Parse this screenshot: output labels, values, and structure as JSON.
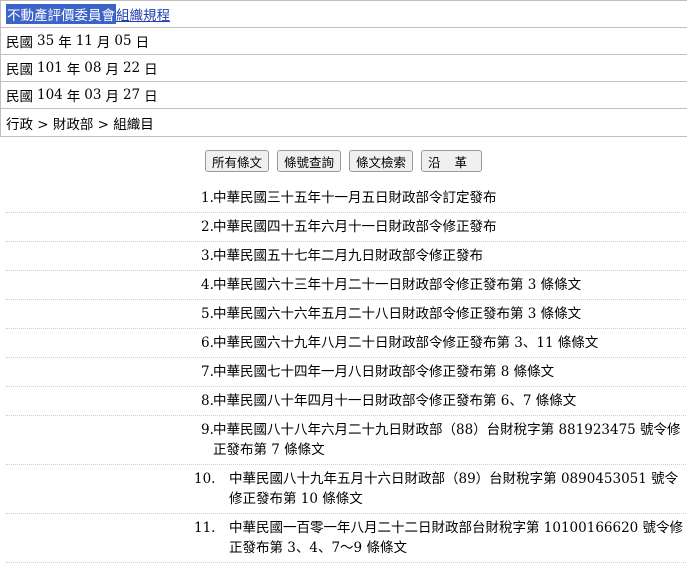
{
  "header": {
    "title_selected": "不動產評價委員會",
    "title_link": "組織規程",
    "dates": [
      {
        "prefix": "民國",
        "year": "35",
        "y": "年",
        "month": "11",
        "m": "月",
        "day": "05",
        "d": "日"
      },
      {
        "prefix": "民國",
        "year": "101",
        "y": "年",
        "month": "08",
        "m": "月",
        "day": "22",
        "d": "日"
      },
      {
        "prefix": "民國",
        "year": "104",
        "y": "年",
        "month": "03",
        "m": "月",
        "day": "27",
        "d": "日"
      }
    ],
    "breadcrumb": "行政 > 財政部 > 組織目"
  },
  "buttons": {
    "all_articles": "所有條文",
    "article_query": "條號查詢",
    "article_search": "條文檢索",
    "history": "沿革"
  },
  "history": [
    {
      "no": "1.",
      "text": "中華民國三十五年十一月五日財政部令訂定發布"
    },
    {
      "no": "2.",
      "text": "中華民國四十五年六月十一日財政部令修正發布"
    },
    {
      "no": "3.",
      "text": "中華民國五十七年二月九日財政部令修正發布"
    },
    {
      "no": "4.",
      "text": "中華民國六十三年十月二十一日財政部令修正發布第 3  條條文"
    },
    {
      "no": "5.",
      "text": "中華民國六十六年五月二十八日財政部令修正發布第 3  條條文"
    },
    {
      "no": "6.",
      "text": "中華民國六十九年八月二十日財政部令修正發布第 3、11  條條文"
    },
    {
      "no": "7.",
      "text": "中華民國七十四年一月八日財政部令修正發布第 8  條條文"
    },
    {
      "no": "8.",
      "text": "中華民國八十年四月十一日財政部令修正發布第 6、7 條條文"
    },
    {
      "no": "9.",
      "text": "中華民國八十八年六月二十九日財政部（88）台財稅字第 881923475 號令修正發布第 7  條條文"
    },
    {
      "no": "10.",
      "text": "中華民國八十九年五月十六日財政部（89）台財稅字第 0890453051 號令修正發布第 10 條條文"
    },
    {
      "no": "11.",
      "text": "中華民國一百零一年八月二十二日財政部台財稅字第 10100166620 號令修正發布第 3、4、7～9 條條文"
    }
  ]
}
